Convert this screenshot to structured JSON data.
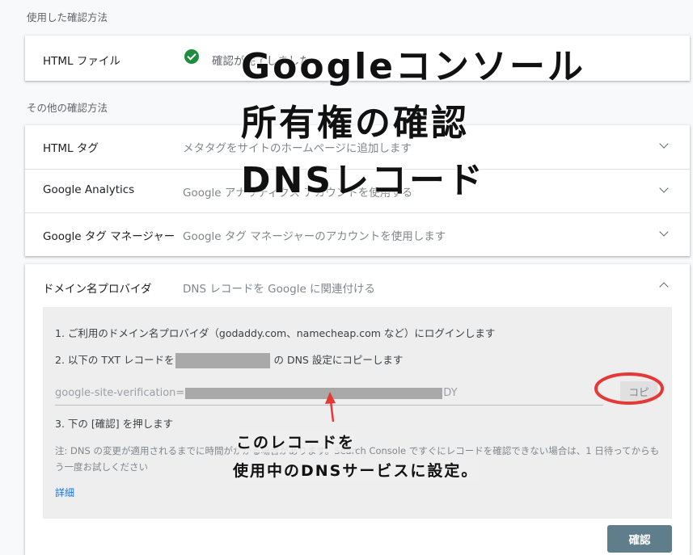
{
  "used_section": {
    "label": "使用した確認方法",
    "method_name": "HTML ファイル",
    "status": "確認が完了しました"
  },
  "other_section": {
    "label": "その他の確認方法",
    "methods": [
      {
        "name": "HTML タグ",
        "desc": "メタタグをサイトのホームページに追加します"
      },
      {
        "name": "Google Analytics",
        "desc": "Google アナリティクス アカウントを使用する"
      },
      {
        "name": "Google タグ マネージャー",
        "desc": "Google タグ マネージャーのアカウントを使用します"
      },
      {
        "name": "ドメイン名プロバイダ",
        "desc": "DNS レコードを Google に関連付ける"
      }
    ]
  },
  "dns_panel": {
    "step1": "1. ご利用のドメイン名プロバイダ（godaddy.com、namecheap.com など）にログインします",
    "step2_prefix": "2. 以下の TXT レコードを",
    "step2_suffix": "の DNS 設定にコピーします",
    "token_prefix": "google-site-verification=",
    "token_suffix": "DY",
    "copy_label": "コピ",
    "step3": "3. 下の [確認] を押します",
    "note": "注: DNS の変更が適用されるまでに時間がかかる場合があります。Search Console ですぐにレコードを確認できない場合は、1 日待ってからもう一度お試しください",
    "details_link": "詳細",
    "confirm_label": "確認"
  },
  "overlay": {
    "line1": "Googleコンソール",
    "line2": "所有権の確認",
    "line3": "DNSレコード",
    "callout1": "このレコードを",
    "callout2": "使用中のDNSサービスに設定。"
  },
  "colors": {
    "success": "#1e8e3e",
    "confirm_button": "#607d8b",
    "annotation": "#e53935",
    "link": "#1a73e8"
  }
}
